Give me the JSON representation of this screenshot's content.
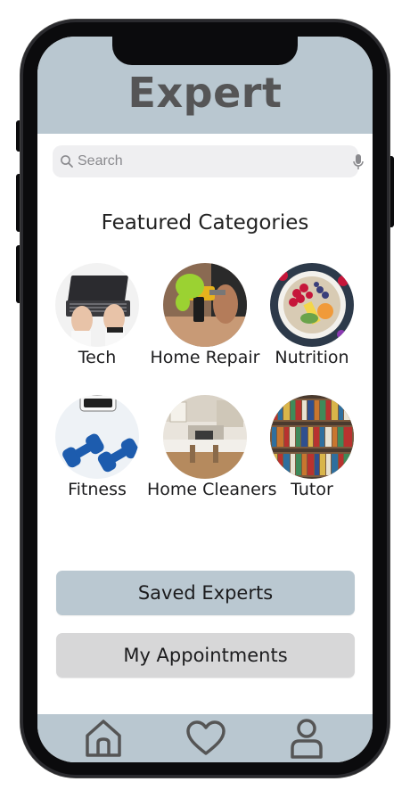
{
  "app": {
    "title": "Expert"
  },
  "search": {
    "placeholder": "Search",
    "value": ""
  },
  "featured": {
    "title": "Featured Categories",
    "categories": [
      {
        "label": "Tech",
        "icon": "laptop-typing-photo"
      },
      {
        "label": "Home Repair",
        "icon": "power-drill-photo"
      },
      {
        "label": "Nutrition",
        "icon": "fruit-bowl-photo"
      },
      {
        "label": "Fitness",
        "icon": "dumbbells-photo"
      },
      {
        "label": "Home Cleaners",
        "icon": "kitchen-photo"
      },
      {
        "label": "Tutor",
        "icon": "bookshelf-photo"
      }
    ]
  },
  "actions": {
    "saved_label": "Saved Experts",
    "appointments_label": "My Appointments"
  },
  "tabbar": {
    "items": [
      {
        "icon": "home-icon"
      },
      {
        "icon": "heart-icon"
      },
      {
        "icon": "user-icon"
      }
    ]
  },
  "colors": {
    "header": "#b9c7d0",
    "saved_button": "#bac8d1",
    "appointments_button": "#d7d7d8",
    "title_text": "#555556"
  }
}
